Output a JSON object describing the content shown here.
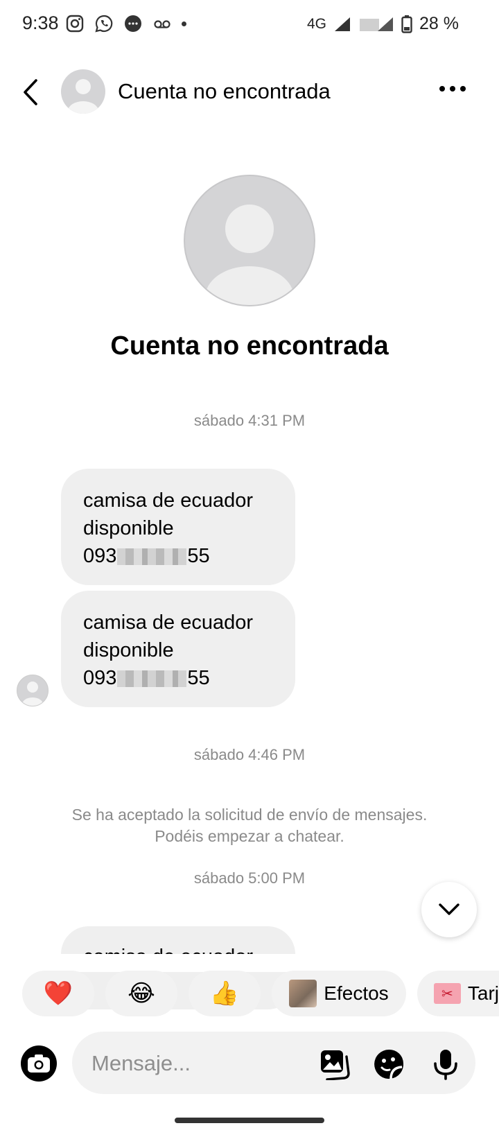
{
  "status_bar": {
    "time": "9:38",
    "network": "4G",
    "battery": "28 %",
    "icons": [
      "instagram-icon",
      "whatsapp-icon",
      "messages-icon",
      "voicemail-icon"
    ]
  },
  "header": {
    "title": "Cuenta no encontrada"
  },
  "profile": {
    "name": "Cuenta no encontrada"
  },
  "messages": {
    "timestamp_1": "sábado 4:31 PM",
    "bubble_1": {
      "line1": "camisa de ecuador",
      "line2": "disponible",
      "phone_prefix": "093",
      "phone_suffix": "55"
    },
    "bubble_2": {
      "line1": "camisa de ecuador",
      "line2": "disponible",
      "phone_prefix": "093",
      "phone_suffix": "55"
    },
    "timestamp_2": "sábado 4:46 PM",
    "system_message": "Se ha aceptado la solicitud de envío de mensajes. Podéis empezar a chatear.",
    "timestamp_3": "sábado 5:00 PM",
    "bubble_3_partial": "camisa de ecuador"
  },
  "quick_replies": {
    "heart": "❤️",
    "laugh": "😂",
    "thumbs_up": "👍",
    "effects_label": "Efectos",
    "cards_label": "Tarj"
  },
  "composer": {
    "placeholder": "Mensaje..."
  }
}
